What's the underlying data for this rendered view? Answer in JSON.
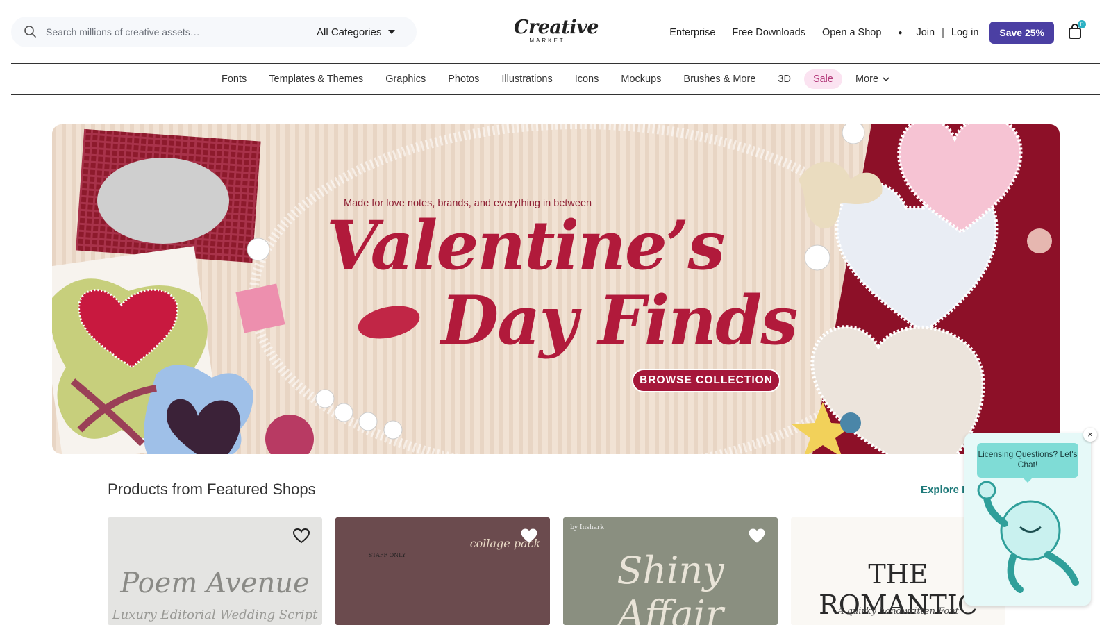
{
  "header": {
    "search": {
      "placeholder": "Search millions of creative assets…",
      "category": "All Categories"
    },
    "logo": {
      "main": "Creative",
      "sub": "MARKET"
    },
    "links": [
      "Enterprise",
      "Free Downloads",
      "Open a Shop"
    ],
    "join": "Join",
    "separator": "|",
    "login": "Log in",
    "save_button": "Save 25%",
    "cart_count": "0"
  },
  "category_nav": {
    "items": [
      "Fonts",
      "Templates & Themes",
      "Graphics",
      "Photos",
      "Illustrations",
      "Icons",
      "Mockups",
      "Brushes & More",
      "3D"
    ],
    "sale": "Sale",
    "more": "More"
  },
  "banner": {
    "tagline": "Made for love notes, brands, and everything in between",
    "title_line1": "Valentine’s",
    "title_line2": "Day Finds",
    "cta": "BROWSE COLLECTION",
    "colors": {
      "title": "#b11a3b",
      "cta": "#a5173a",
      "background": "#efe1d3"
    }
  },
  "featured": {
    "title": "Products from Featured Shops",
    "explore": "Explore F",
    "cards": [
      {
        "title": "Poem Avenue",
        "subtitle": "Luxury Editorial Wedding Script"
      },
      {
        "title": "collage pack",
        "subtitle": "STAFF ONLY"
      },
      {
        "title": "Shiny Affair",
        "subtitle": "by Inshark"
      },
      {
        "title": "THE ROMANTIC",
        "subtitle": "A quirky handwritten Font"
      }
    ]
  },
  "chat": {
    "bubble": "Licensing Questions? Let's Chat!",
    "close": "×"
  },
  "accent_color": "#4b3fa3"
}
